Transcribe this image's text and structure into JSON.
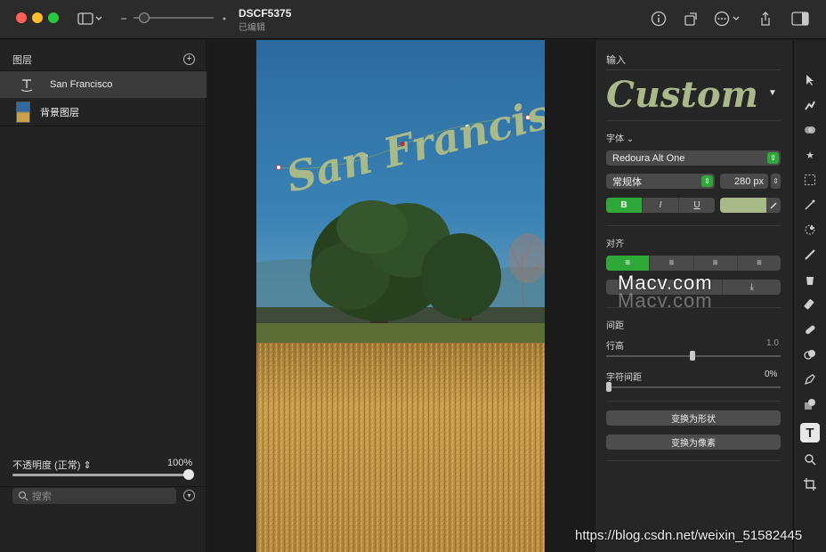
{
  "window": {
    "doc_title": "DSCF5375",
    "doc_subtitle": "已编辑"
  },
  "layers_panel": {
    "title": "图层",
    "layers": [
      {
        "name": "San Francisco",
        "type": "text-layer-icon",
        "selected": true
      },
      {
        "name": "背景图层",
        "type": "image-layer-icon",
        "selected": false
      }
    ],
    "opacity_label": "不透明度 (正常) ⇕",
    "opacity_value": "100%",
    "search_placeholder": "搜索"
  },
  "canvas": {
    "text_layer": "San Francisco"
  },
  "inspector": {
    "input_label": "输入",
    "preset_name": "Custom",
    "font_label": "字体 ⌄",
    "font_family": "Redoura Alt One",
    "font_style": "常规体",
    "font_size": "280 px",
    "format_buttons": [
      "B",
      "I",
      "U"
    ],
    "text_color": "#a9b98a",
    "align_label": "对齐",
    "align_buttons": [
      "≡",
      "≡",
      "≡",
      "≡"
    ],
    "spacing_label": "间距",
    "line_height_label": "行高",
    "line_height_value": "1.0",
    "letter_spacing_label": "字符间距",
    "letter_spacing_value": "0%",
    "convert_shape_label": "变换为形状",
    "convert_pixels_label": "变换为像素"
  },
  "tools": [
    "arrow-icon",
    "retouch-icon",
    "effects-icon",
    "star-icon",
    "marquee-icon",
    "magic-wand-icon",
    "brush-select-icon",
    "paint-brush-icon",
    "paint-bucket-icon",
    "eraser-icon",
    "bandage-icon",
    "clone-icon",
    "pen-icon",
    "shapes-icon",
    "text-icon",
    "zoom-icon",
    "crop-icon"
  ],
  "watermark": {
    "site": "Macv.com",
    "url": "https://blog.csdn.net/weixin_51582445"
  },
  "colors": {
    "accent_green": "#2fa83a",
    "panel_bg": "#262626",
    "text_fill": "#a9b98a"
  }
}
